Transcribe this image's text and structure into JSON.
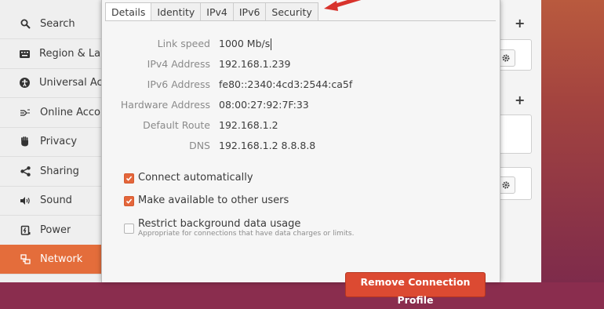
{
  "sidebar": {
    "items": [
      {
        "label": "Search",
        "icon": "search-icon"
      },
      {
        "label": "Region & Language",
        "icon": "keyboard-icon"
      },
      {
        "label": "Universal Access",
        "icon": "accessibility-icon"
      },
      {
        "label": "Online Accounts",
        "icon": "online-accounts-icon"
      },
      {
        "label": "Privacy",
        "icon": "hand-icon"
      },
      {
        "label": "Sharing",
        "icon": "share-icon"
      },
      {
        "label": "Sound",
        "icon": "speaker-icon"
      },
      {
        "label": "Power",
        "icon": "battery-icon"
      },
      {
        "label": "Network",
        "icon": "network-icon"
      }
    ],
    "active_index": 8
  },
  "dialog": {
    "tabs": [
      "Details",
      "Identity",
      "IPv4",
      "IPv6",
      "Security"
    ],
    "active_tab": "Details",
    "details": {
      "link_speed_label": "Link speed",
      "link_speed": "1000 Mb/s",
      "ipv4_label": "IPv4 Address",
      "ipv4": "192.168.1.239",
      "ipv6_label": "IPv6 Address",
      "ipv6": "fe80::2340:4cd3:2544:ca5f",
      "hw_label": "Hardware Address",
      "hw": "08:00:27:92:7F:33",
      "route_label": "Default Route",
      "route": "192.168.1.2",
      "dns_label": "DNS",
      "dns": "192.168.1.2 8.8.8.8"
    },
    "options": {
      "connect_auto": {
        "label": "Connect automatically",
        "checked": true
      },
      "available_all": {
        "label": "Make available to other users",
        "checked": true
      },
      "restrict_bg": {
        "label": "Restrict background data usage",
        "sub": "Appropriate for connections that have data charges or limits.",
        "checked": false
      }
    },
    "remove_label": "Remove Connection Profile"
  },
  "colors": {
    "accent": "#e46d3b",
    "danger": "#dc4a32"
  }
}
